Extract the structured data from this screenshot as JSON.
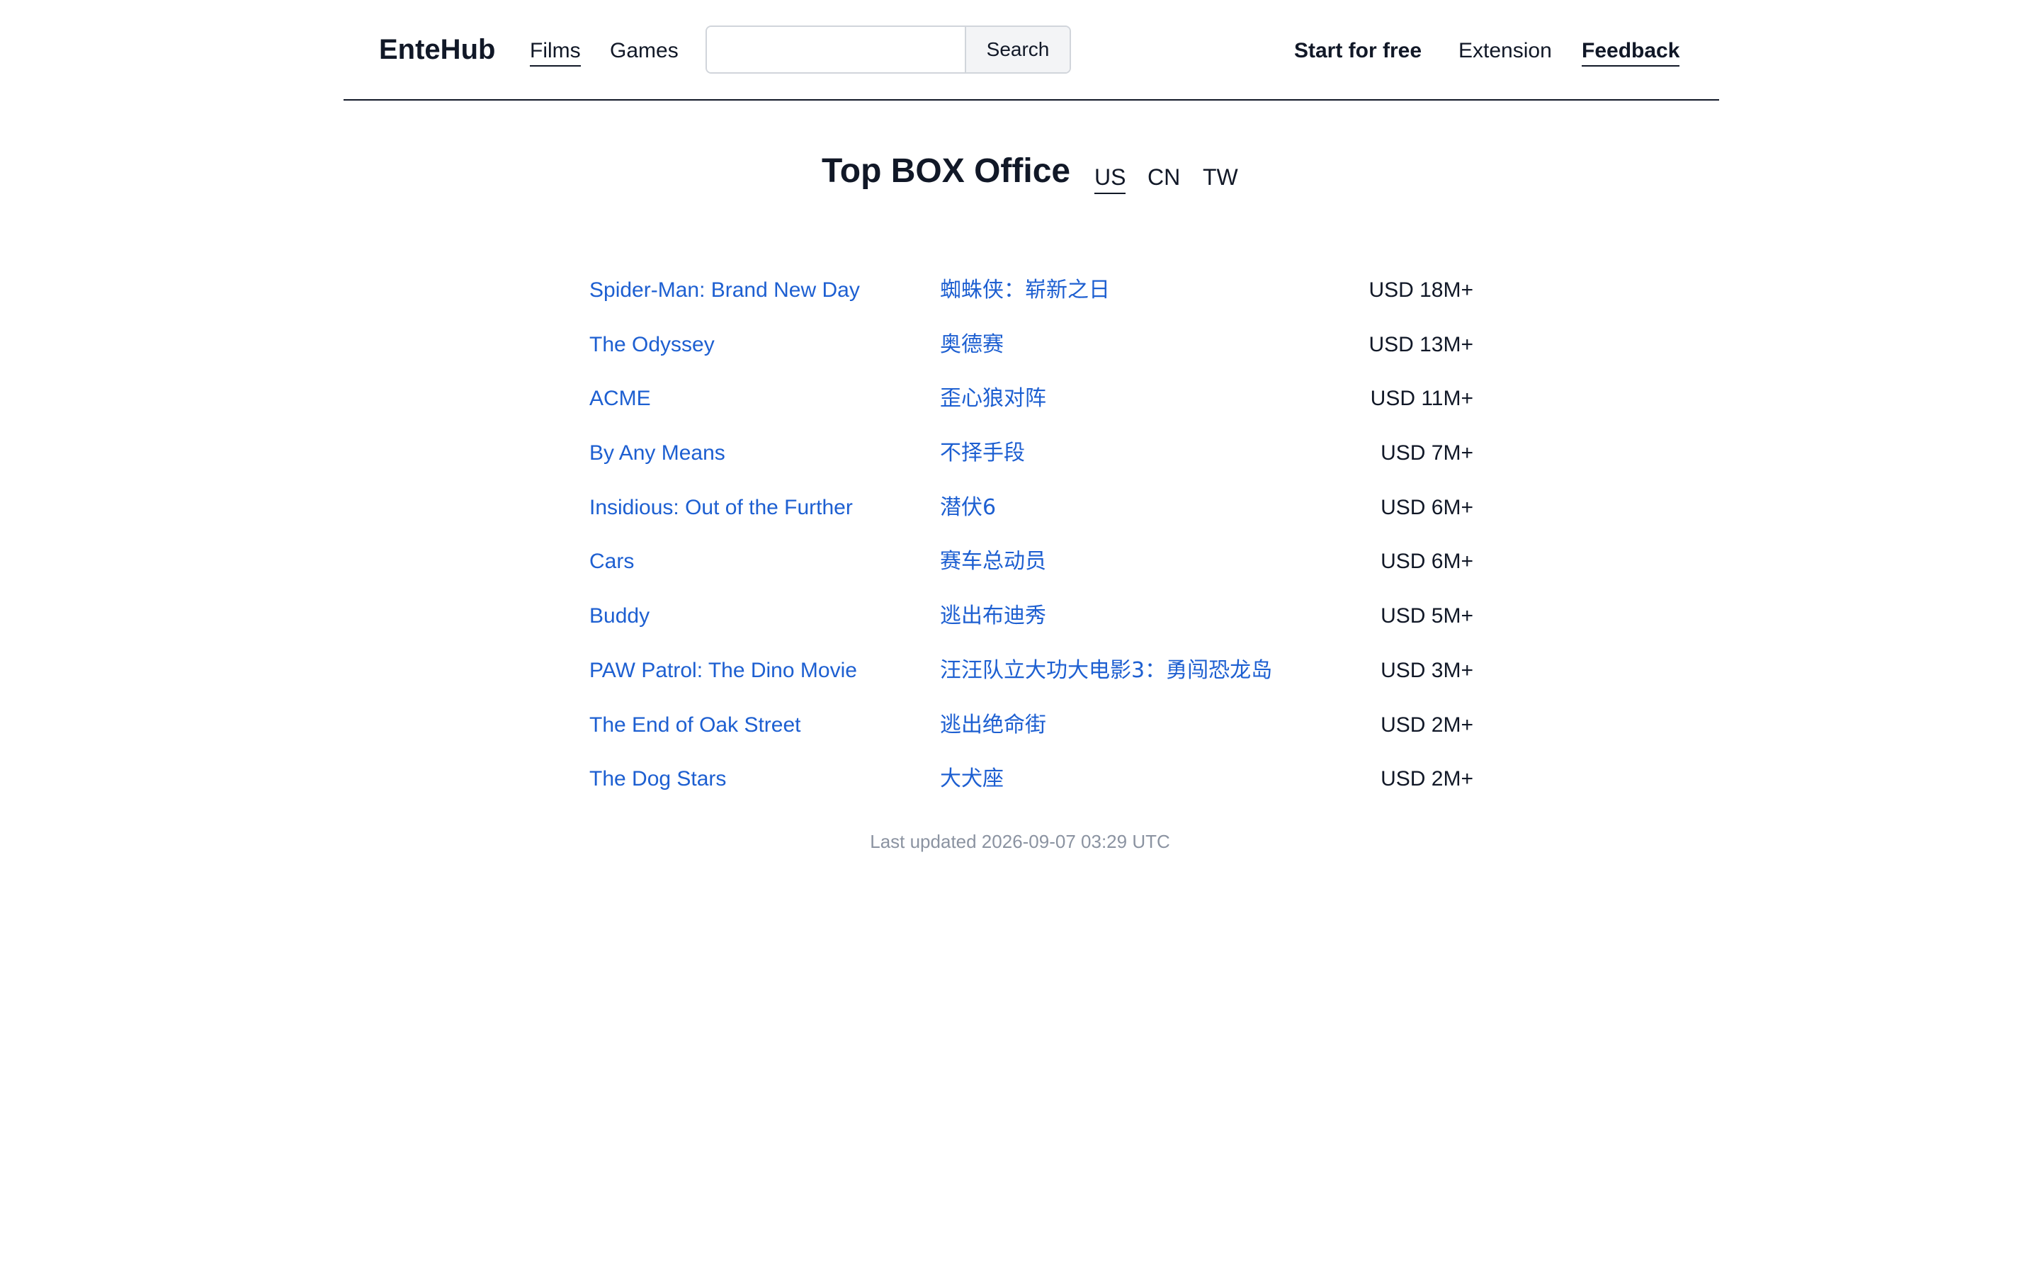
{
  "header": {
    "brand": "EnteHub",
    "nav": [
      {
        "label": "Films",
        "active": true
      },
      {
        "label": "Games",
        "active": false
      }
    ],
    "search": {
      "value": "",
      "placeholder": "",
      "button_label": "Search"
    },
    "right_links": {
      "start": "Start for free",
      "extension": "Extension",
      "feedback": "Feedback"
    }
  },
  "main": {
    "title": "Top BOX Office",
    "regions": [
      {
        "label": "US",
        "active": true
      },
      {
        "label": "CN",
        "active": false
      },
      {
        "label": "TW",
        "active": false
      }
    ],
    "films": [
      {
        "title": "Spider-Man: Brand New Day",
        "cn_title": "蜘蛛侠：崭新之日",
        "gross": "USD 18M+"
      },
      {
        "title": "The Odyssey",
        "cn_title": "奥德赛",
        "gross": "USD 13M+"
      },
      {
        "title": "ACME",
        "cn_title": "歪心狼对阵",
        "gross": "USD 11M+"
      },
      {
        "title": "By Any Means",
        "cn_title": "不择手段",
        "gross": "USD 7M+"
      },
      {
        "title": "Insidious: Out of the Further",
        "cn_title": "潜伏6",
        "gross": "USD 6M+"
      },
      {
        "title": "Cars",
        "cn_title": "赛车总动员",
        "gross": "USD 6M+"
      },
      {
        "title": "Buddy",
        "cn_title": "逃出布迪秀",
        "gross": "USD 5M+"
      },
      {
        "title": "PAW Patrol: The Dino Movie",
        "cn_title": "汪汪队立大功大电影3：勇闯恐龙岛",
        "gross": "USD 3M+"
      },
      {
        "title": "The End of Oak Street",
        "cn_title": "逃出绝命街",
        "gross": "USD 2M+"
      },
      {
        "title": "The Dog Stars",
        "cn_title": "大犬座",
        "gross": "USD 2M+"
      }
    ],
    "last_updated": "Last updated 2026-09-07 03:29 UTC"
  },
  "colors": {
    "link": "#1d5fd1",
    "text": "#111827",
    "muted": "#8b93a1"
  }
}
